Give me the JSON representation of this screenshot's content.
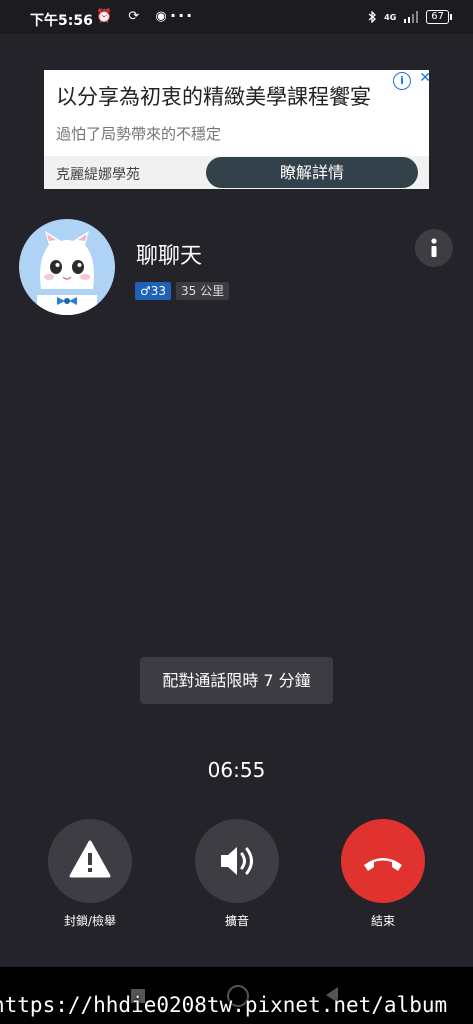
{
  "status_bar": {
    "time": "下午5:56",
    "left_icons": "⏰ ⟳ ◉",
    "dots": "···",
    "network": "4G",
    "battery": "67"
  },
  "ad": {
    "title": "以分享為初衷的精緻美學課程饗宴",
    "subtitle": "過怕了局勢帶來的不穩定",
    "brand": "克麗緹娜學苑",
    "cta": "瞭解詳情",
    "info_icon": "i",
    "close_icon": "✕"
  },
  "profile": {
    "name": "聊聊天",
    "gender_badge": "♂33",
    "distance_badge": "35 公里"
  },
  "call": {
    "toast": "配對通話限時 7 分鐘",
    "timer": "06:55",
    "block_label": "封鎖/檢舉",
    "speaker_label": "擴音",
    "end_label": "結束"
  },
  "watermark": "https://hhdie0208tw.pixnet.net/album",
  "colors": {
    "background": "#242329",
    "end_call": "#e0322e",
    "gender_badge": "#1e62b8",
    "ad_button": "#32414a"
  }
}
